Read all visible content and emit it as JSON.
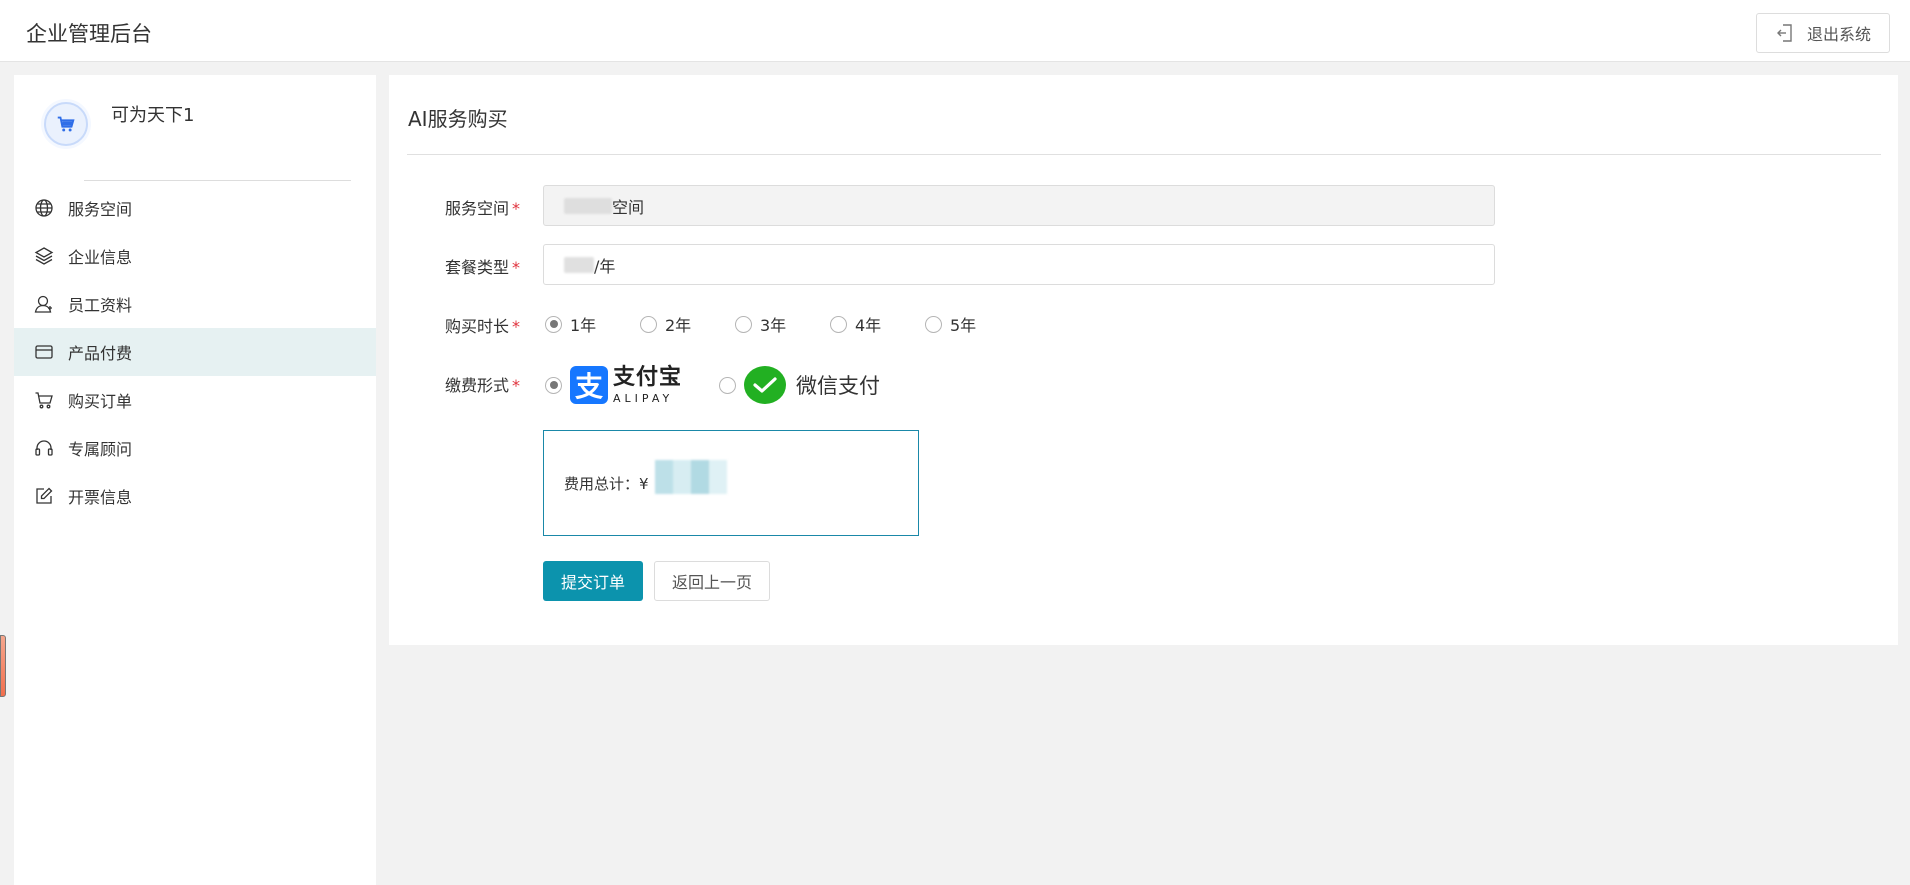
{
  "header": {
    "app_title": "企业管理后台",
    "logout_label": "退出系统"
  },
  "sidebar": {
    "profile_name": "可为天下1",
    "items": [
      {
        "label": "服务空间",
        "icon": "globe-icon"
      },
      {
        "label": "企业信息",
        "icon": "layers-icon"
      },
      {
        "label": "员工资料",
        "icon": "user-icon"
      },
      {
        "label": "产品付费",
        "icon": "credit-card-icon",
        "active": true
      },
      {
        "label": "购买订单",
        "icon": "cart-icon"
      },
      {
        "label": "专属顾问",
        "icon": "headset-icon"
      },
      {
        "label": "开票信息",
        "icon": "edit-icon"
      }
    ]
  },
  "main": {
    "title": "AI服务购买",
    "fields": {
      "space_label": "服务空间",
      "space_value": "空间",
      "plan_label": "套餐类型",
      "plan_value": "/年",
      "duration_label": "购买时长",
      "duration_options": [
        "1年",
        "2年",
        "3年",
        "4年",
        "5年"
      ],
      "duration_selected": "1年",
      "payment_label": "缴费形式",
      "required_mark": "*"
    },
    "payment": {
      "alipay_cn": "支付宝",
      "alipay_en": "ALIPAY",
      "alipay_mark": "支",
      "wechat_label": "微信支付",
      "selected": "alipay"
    },
    "total_label": "费用总计：¥",
    "submit_label": "提交订单",
    "back_label": "返回上一页"
  },
  "colors": {
    "accent": "#0c93ad",
    "active_menu_bg": "#e6f1f2",
    "required": "#e0323c",
    "alipay_blue": "#1677ff",
    "wechat_green": "#22b022"
  }
}
